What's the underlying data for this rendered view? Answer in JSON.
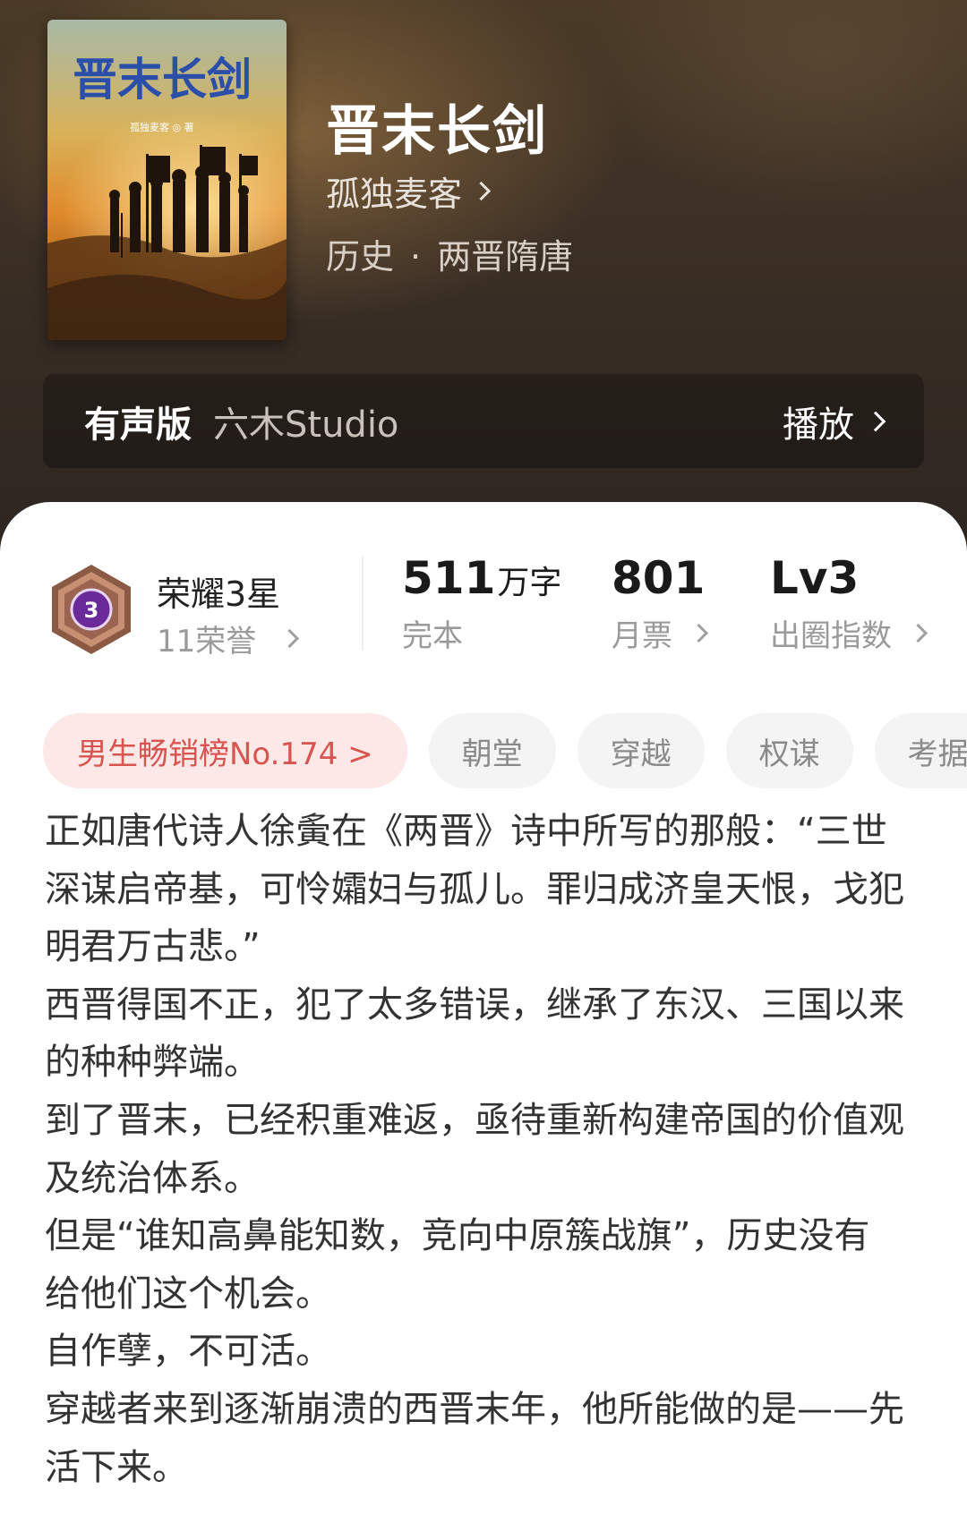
{
  "book": {
    "cover_title": "晋末长剑",
    "cover_author": "孤独麦客 ◎ 著",
    "title": "晋末长剑",
    "author": "孤独麦客",
    "genre": "历史",
    "genre_separator": "·",
    "subgenre": "两晋隋唐"
  },
  "audio": {
    "label": "有声版",
    "studio": "六木Studio",
    "play_label": "播放"
  },
  "stats": {
    "honor_title": "荣耀3星",
    "honor_count": "11荣誉",
    "badge_number": "3",
    "words_value": "511",
    "words_unit": "万字",
    "words_label": "完本",
    "tickets_value": "801",
    "tickets_label": "月票",
    "index_value": "Lv3",
    "index_label": "出圈指数"
  },
  "tags": [
    {
      "label": "男生畅销榜No.174 >"
    },
    {
      "label": "朝堂"
    },
    {
      "label": "穿越"
    },
    {
      "label": "权谋"
    },
    {
      "label": "考据"
    }
  ],
  "synopsis": [
    "正如唐代诗人徐夤在《两晋》诗中所写的那般：“三世深谋启帝基，可怜孀妇与孤儿。罪归成济皇天恨，戈犯明君万古悲。”",
    "西晋得国不正，犯了太多错误，继承了东汉、三国以来的种种弊端。",
    "到了晋末，已经积重难返，亟待重新构建帝国的价值观及统治体系。",
    "但是“谁知高鼻能知数，竞向中原簇战旗”，历史没有给他们这个机会。",
    "自作孽，不可活。",
    "穿越者来到逐渐崩溃的西晋末年，他所能做的是——先活下来。"
  ],
  "colors": {
    "rank_tag_text": "#d9534f",
    "rank_tag_bg": "#fde8e8",
    "badge_purple": "#6a2a9a"
  }
}
